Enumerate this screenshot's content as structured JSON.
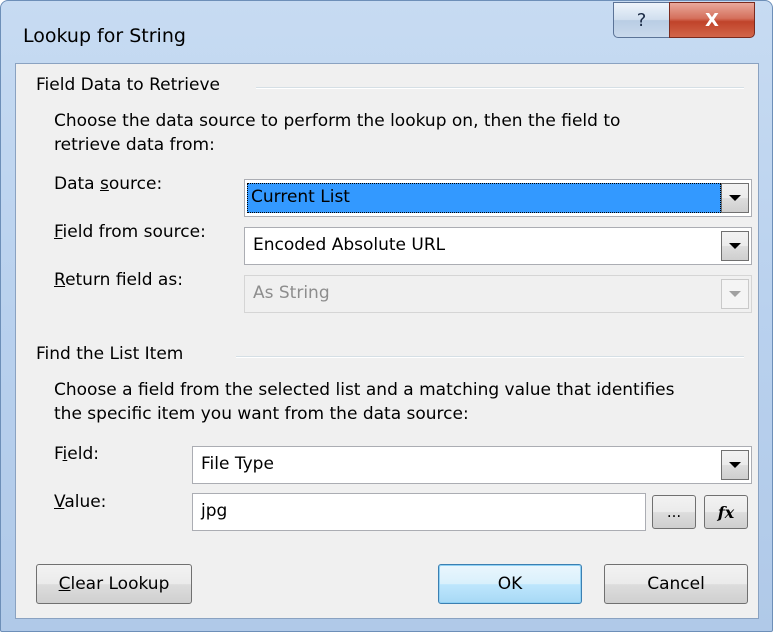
{
  "window": {
    "title": "Lookup for String",
    "help_glyph": "?",
    "close_glyph": "X"
  },
  "field_data": {
    "group_title": "Field Data to Retrieve",
    "description_line1": "Choose the data source to perform the lookup on, then the field to",
    "description_line2": "retrieve data from:",
    "data_source": {
      "label_pre": "Data ",
      "label_key": "s",
      "label_post": "ource:",
      "value": "Current List"
    },
    "field_from_source": {
      "label_pre": "",
      "label_key": "F",
      "label_post": "ield from source:",
      "value": "Encoded Absolute URL"
    },
    "return_field_as": {
      "label_pre": "",
      "label_key": "R",
      "label_post": "eturn field as:",
      "value": "As String",
      "disabled": true
    }
  },
  "find_item": {
    "group_title": "Find the List Item",
    "description_line1": "Choose a field from the selected list and a matching value that identifies",
    "description_line2": "the specific item you want from the data source:",
    "field": {
      "label_pre": "F",
      "label_key": "i",
      "label_post": "eld:",
      "value": "File Type"
    },
    "value": {
      "label_pre": "",
      "label_key": "V",
      "label_post": "alue:",
      "value": "jpg"
    },
    "browse_label": "...",
    "formula_label": "fx"
  },
  "buttons": {
    "clear_lookup": {
      "key": "C",
      "rest": "lear Lookup"
    },
    "ok": "OK",
    "cancel": "Cancel"
  },
  "colors": {
    "selection_highlight": "#3399ff",
    "close_button": "#c7503a",
    "dialog_face": "#f0f0f0"
  }
}
